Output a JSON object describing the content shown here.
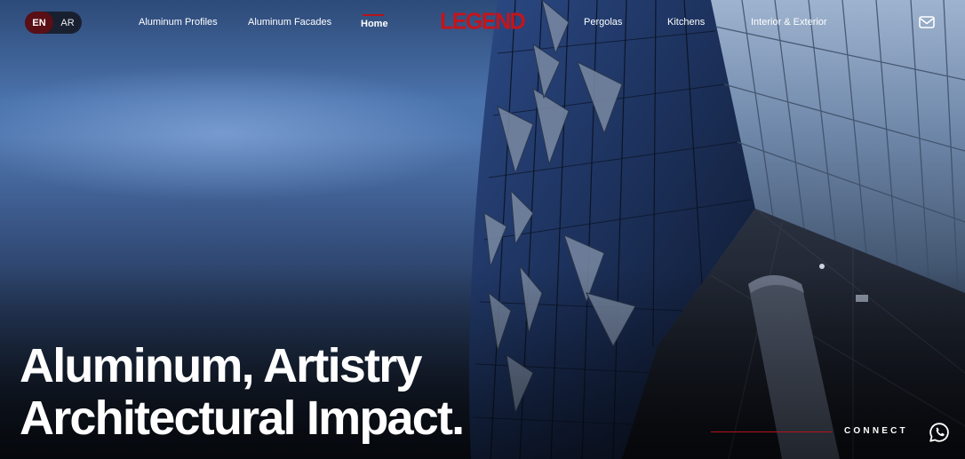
{
  "language_toggle": {
    "options": [
      "EN",
      "AR"
    ],
    "selected": "EN"
  },
  "nav": {
    "left_links": [
      "Aluminum Profiles",
      "Aluminum Facades",
      "Home"
    ],
    "current": "Home",
    "logo_text": "LEGEND",
    "right_links": [
      "Pergolas",
      "Kitchens",
      "Interior & Exterior"
    ],
    "contact_icon": "mail-icon"
  },
  "hero": {
    "headline_line1": "Aluminum, Artistry",
    "headline_line2": "Architectural Impact.",
    "background": "building-facade-photo"
  },
  "connect": {
    "label": "CONNECT",
    "icon": "whatsapp-icon"
  },
  "colors": {
    "accent_red": "#c4141c",
    "active_lang_bg": "#5a0e16",
    "text": "#ffffff"
  }
}
